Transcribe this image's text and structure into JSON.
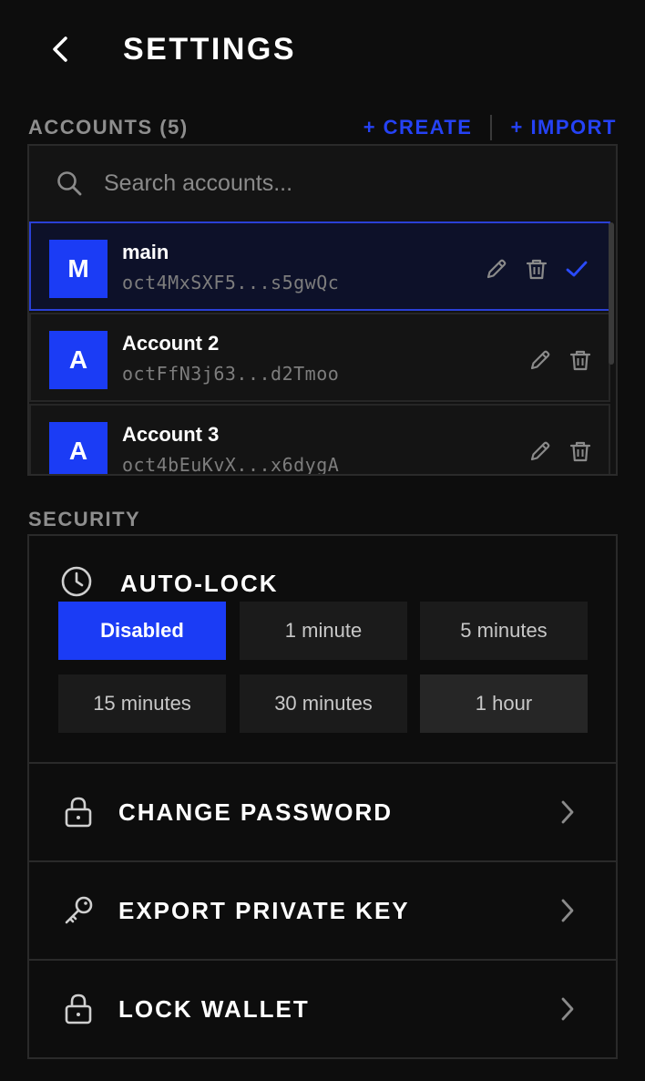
{
  "header": {
    "title": "SETTINGS"
  },
  "accounts": {
    "section_label": "ACCOUNTS (5)",
    "create_label": "+ CREATE",
    "import_label": "+ IMPORT",
    "search_placeholder": "Search accounts...",
    "items": [
      {
        "initial": "M",
        "name": "main",
        "address": "oct4MxSXF5...s5gwQc",
        "selected": true
      },
      {
        "initial": "A",
        "name": "Account 2",
        "address": "octFfN3j63...d2Tmoo",
        "selected": false
      },
      {
        "initial": "A",
        "name": "Account 3",
        "address": "oct4bEuKvX...x6dygA",
        "selected": false
      }
    ]
  },
  "security": {
    "section_label": "SECURITY",
    "autolock": {
      "title": "AUTO-LOCK",
      "options": [
        "Disabled",
        "1 minute",
        "5 minutes",
        "15 minutes",
        "30 minutes",
        "1 hour"
      ],
      "selected": "Disabled"
    },
    "rows": [
      {
        "label": "CHANGE PASSWORD",
        "icon": "lock-icon"
      },
      {
        "label": "EXPORT PRIVATE KEY",
        "icon": "key-icon"
      },
      {
        "label": "LOCK WALLET",
        "icon": "lock-icon"
      }
    ]
  },
  "colors": {
    "accent": "#1b3cf5",
    "link": "#2542f5",
    "background": "#0d0d0d",
    "muted_text": "#8e8e8e"
  }
}
